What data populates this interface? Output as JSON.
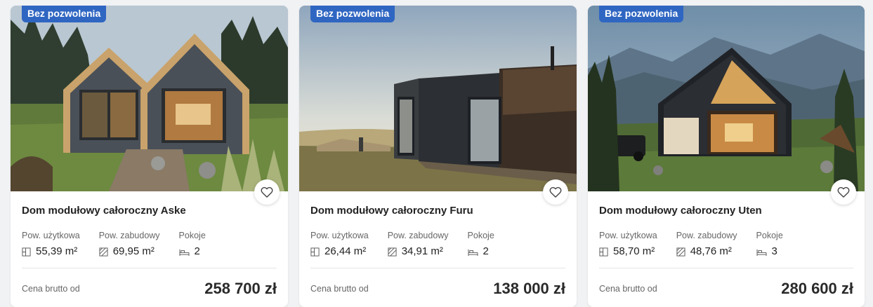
{
  "cards": [
    {
      "badge": "Bez pozwolenia",
      "title": "Dom modułowy całoroczny Aske",
      "specs": [
        {
          "label": "Pow. użytkowa",
          "value": "55,39 m²",
          "icon": "floor-area-icon"
        },
        {
          "label": "Pow. zabudowy",
          "value": "69,95 m²",
          "icon": "building-area-icon"
        },
        {
          "label": "Pokoje",
          "value": "2",
          "icon": "bed-icon"
        }
      ],
      "price_label": "Cena brutto od",
      "price": "258 700 zł"
    },
    {
      "badge": "Bez pozwolenia",
      "title": "Dom modułowy całoroczny Furu",
      "specs": [
        {
          "label": "Pow. użytkowa",
          "value": "26,44 m²",
          "icon": "floor-area-icon"
        },
        {
          "label": "Pow. zabudowy",
          "value": "34,91 m²",
          "icon": "building-area-icon"
        },
        {
          "label": "Pokoje",
          "value": "2",
          "icon": "bed-icon"
        }
      ],
      "price_label": "Cena brutto od",
      "price": "138 000 zł"
    },
    {
      "badge": "Bez pozwolenia",
      "title": "Dom modułowy całoroczny Uten",
      "specs": [
        {
          "label": "Pow. użytkowa",
          "value": "58,70 m²",
          "icon": "floor-area-icon"
        },
        {
          "label": "Pow. zabudowy",
          "value": "48,76 m²",
          "icon": "building-area-icon"
        },
        {
          "label": "Pokoje",
          "value": "3",
          "icon": "bed-icon"
        }
      ],
      "price_label": "Cena brutto od",
      "price": "280 600 zł"
    }
  ],
  "colors": {
    "badge": "#2f66c2",
    "background": "#f1f2f4",
    "card": "#ffffff"
  },
  "favorite_icon": "heart-outline-icon"
}
